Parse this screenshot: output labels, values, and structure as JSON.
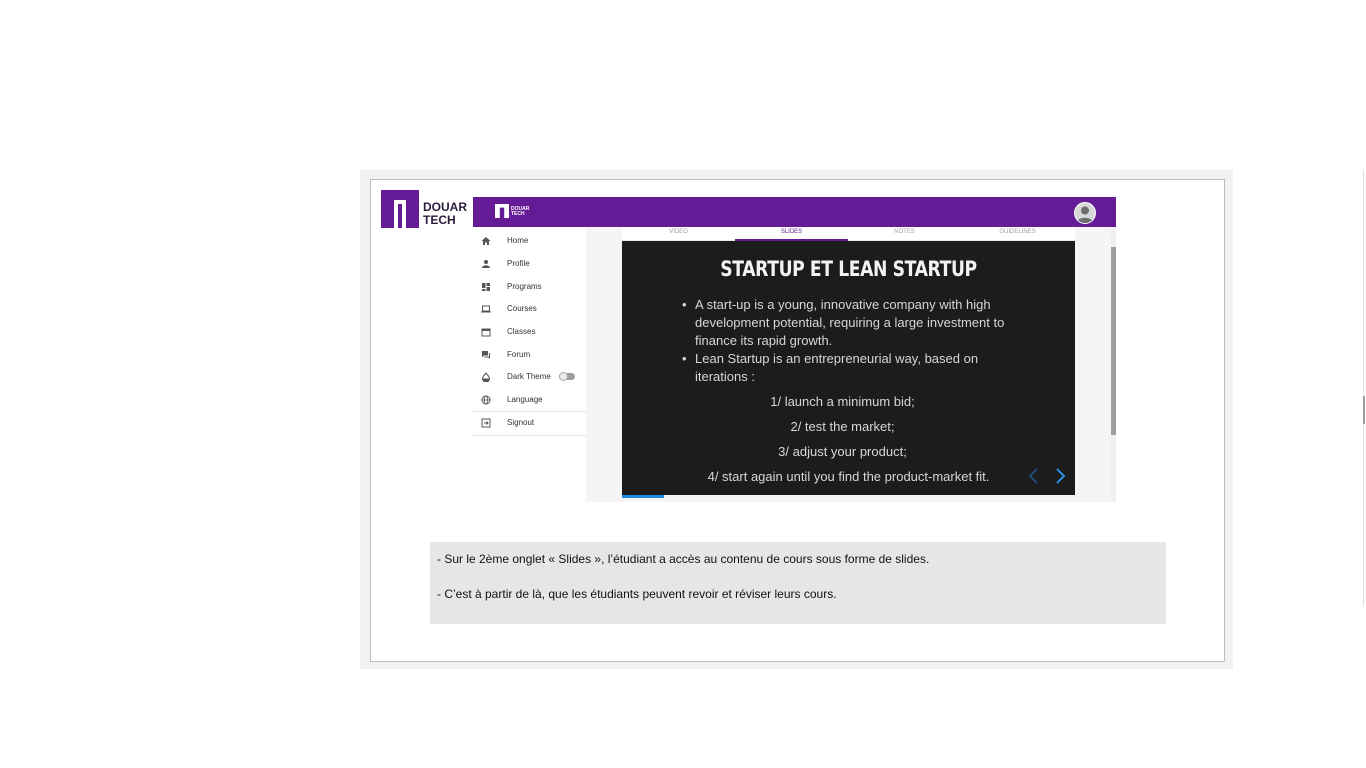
{
  "brand": {
    "logo_line1": "DOUAR",
    "logo_line2": "TECH",
    "color": "#651a96"
  },
  "sidebar": {
    "items": [
      {
        "label": "Home",
        "icon": "home-icon"
      },
      {
        "label": "Profile",
        "icon": "person-icon"
      },
      {
        "label": "Programs",
        "icon": "dashboard-icon"
      },
      {
        "label": "Courses",
        "icon": "laptop-icon"
      },
      {
        "label": "Classes",
        "icon": "calendar-icon"
      },
      {
        "label": "Forum",
        "icon": "forum-icon"
      },
      {
        "label": "Dark Theme",
        "icon": "drop-icon"
      },
      {
        "label": "Language",
        "icon": "globe-icon"
      },
      {
        "label": "Signout",
        "icon": "signout-icon"
      }
    ],
    "dark_theme_enabled": false
  },
  "tabs": [
    {
      "label": "VIDEO"
    },
    {
      "label": "SLIDES"
    },
    {
      "label": "NOTES"
    },
    {
      "label": "GUIDELINES"
    }
  ],
  "active_tab": "SLIDES",
  "slide": {
    "title": "STARTUP ET LEAN STARTUP",
    "bullets": [
      "A start-up is a young, innovative company with high development potential, requiring a large investment to finance its rapid growth.",
      "Lean Startup is an entrepreneurial way, based on iterations :"
    ],
    "steps": [
      "1/ launch a minimum bid;",
      "2/ test the market;",
      "3/ adjust your product;",
      "4/ start again until you find the product-market fit."
    ]
  },
  "notes": {
    "line1": "- Sur le 2ème onglet « Slides », l’étudiant a accès au contenu de cours sous forme de slides.",
    "line2": "- C’est à partir de là, que les étudiants peuvent revoir et réviser leurs cours."
  }
}
